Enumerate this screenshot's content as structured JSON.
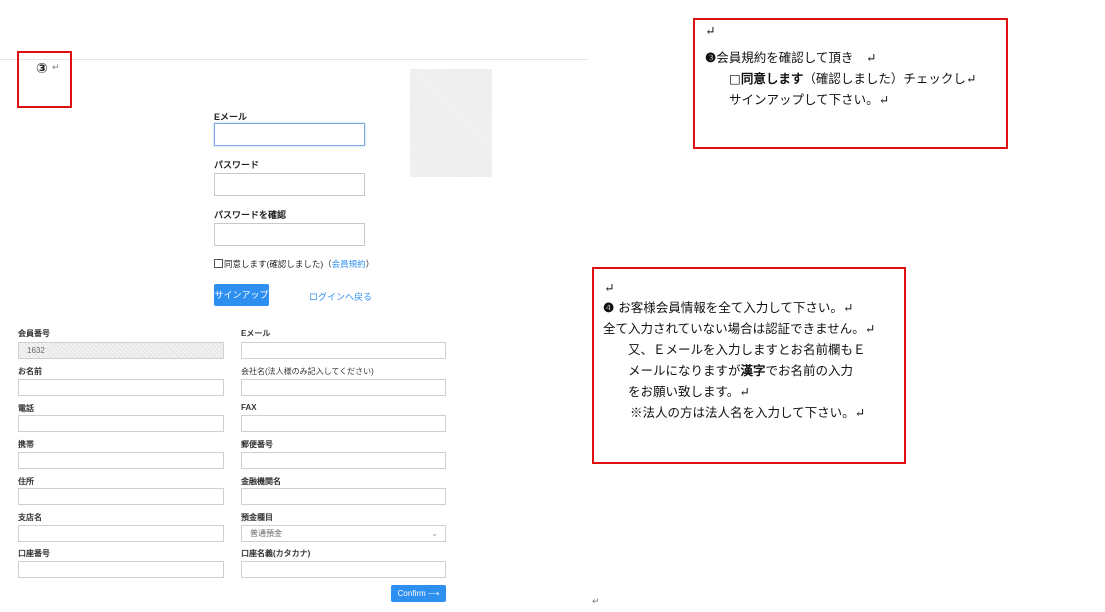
{
  "step3": {
    "marker": "③",
    "para_mark": "↵"
  },
  "signup_form": {
    "email_label": "Eメール",
    "password_label": "パスワード",
    "confirm_password_label": "パスワードを確認",
    "agree_text": "同意します(確認しました)（",
    "terms_link": "会員規約",
    "agree_close": "）",
    "signup_button": "サインアップ",
    "back_to_login": "ログインへ戻る"
  },
  "member_form": {
    "member_no_label": "会員番号",
    "member_no_value": "1632",
    "email_label": "Eメール",
    "name_label": "お名前",
    "company_label": "会社名(法人様のみ記入してください)",
    "phone_label": "電話",
    "fax_label": "FAX",
    "mobile_label": "携帯",
    "postal_label": "郵便番号",
    "address_label": "住所",
    "bank_label": "金融機関名",
    "branch_label": "支店名",
    "account_type_label": "預金種目",
    "account_type_value": "普通預金",
    "account_no_label": "口座番号",
    "account_name_label": "口座名義(カタカナ)",
    "confirm_button": "Confirm ⟶"
  },
  "note3": {
    "blank": "↵",
    "line1_marker": "❸",
    "line1": "会員規約を確認して頂き　↵",
    "line2_box": "□",
    "line2_bold": "同意します",
    "line2": "（確認しました）チェックし↵",
    "line3": "サインアップして下さい。↵"
  },
  "note4": {
    "blank": "↵",
    "line1_marker": "❹",
    "line1": " お客様会員情報を全て入力して下さい。↵",
    "line2": "全て入力されていない場合は認証できません。↵",
    "line3": "又、Ｅメールを入力しますとお名前欄もＥ",
    "line4": "メールになりますが",
    "line4_bold": "漢字",
    "line4_tail": "でお名前の入力",
    "line5": "をお願い致します。↵",
    "line6": "※法人の方は法人名を入力して下さい。↵"
  },
  "bottom_mark": "↵"
}
